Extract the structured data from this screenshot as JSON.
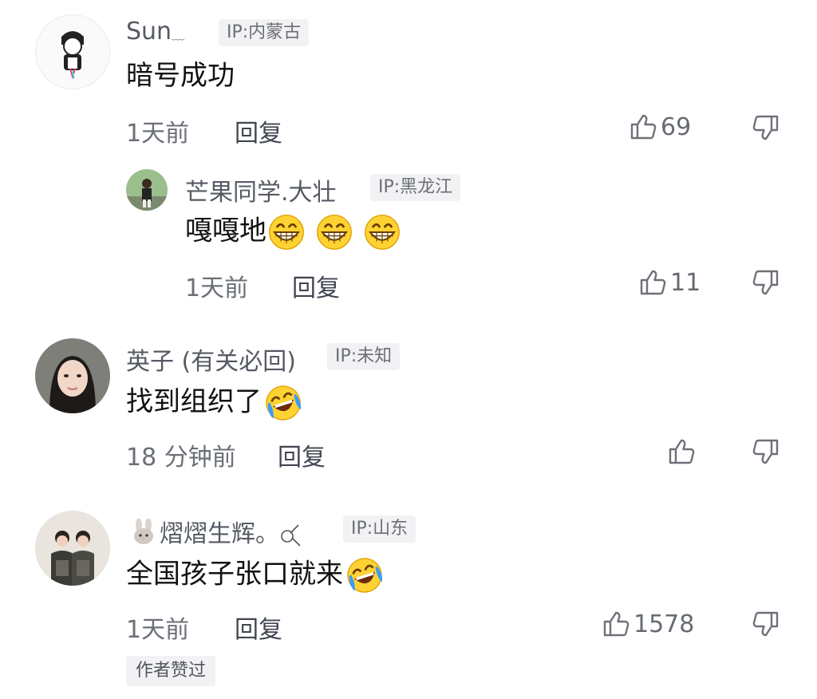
{
  "comments": [
    {
      "username": "Sun",
      "username_suffix": "﹏",
      "ip": "IP:内蒙古",
      "text": "暗号成功",
      "time": "1天前",
      "reply_label": "回复",
      "likes": "69"
    },
    {
      "username": "芒果同学.大壮",
      "ip": "IP:黑龙江",
      "text": "嘎嘎地",
      "time": "1天前",
      "reply_label": "回复",
      "likes": "11"
    },
    {
      "username": "英子 (有关必回)",
      "ip": "IP:未知",
      "text": "找到组织了",
      "time": "18 分钟前",
      "reply_label": "回复",
      "likes": ""
    },
    {
      "username": "熠熠生辉。",
      "ip": "IP:山东",
      "text": "全国孩子张口就来",
      "time": "1天前",
      "reply_label": "回复",
      "likes": "1578",
      "author_liked": "作者赞过"
    }
  ],
  "icons": {
    "like": "thumbs-up-icon",
    "dislike": "thumbs-down-icon",
    "grin": "grinning-emoji",
    "laugh": "laughing-tears-emoji"
  }
}
